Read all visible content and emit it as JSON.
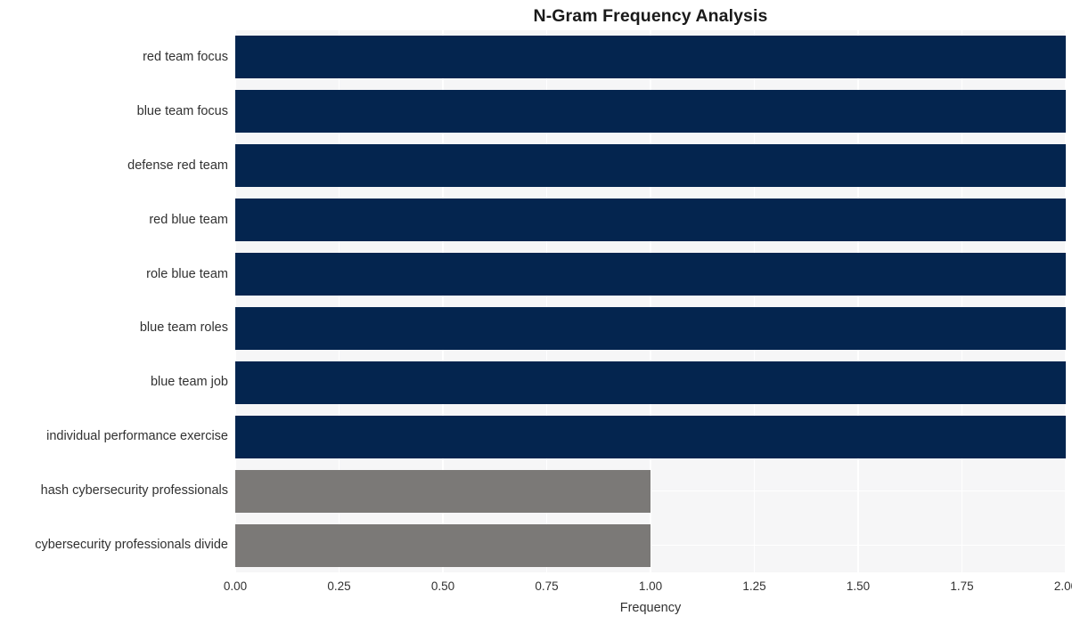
{
  "chart_data": {
    "type": "bar",
    "orientation": "horizontal",
    "title": "N-Gram Frequency Analysis",
    "xlabel": "Frequency",
    "ylabel": "",
    "xlim": [
      0,
      2
    ],
    "ylim": null,
    "grid": true,
    "legend": null,
    "xticks": [
      "0.00",
      "0.25",
      "0.50",
      "0.75",
      "1.00",
      "1.25",
      "1.50",
      "1.75",
      "2.00"
    ],
    "xtick_values": [
      0,
      0.25,
      0.5,
      0.75,
      1.0,
      1.25,
      1.5,
      1.75,
      2.0
    ],
    "categories": [
      "red team focus",
      "blue team focus",
      "defense red team",
      "red blue team",
      "role blue team",
      "blue team roles",
      "blue team job",
      "individual performance exercise",
      "hash cybersecurity professionals",
      "cybersecurity professionals divide"
    ],
    "values": [
      2,
      2,
      2,
      2,
      2,
      2,
      2,
      2,
      1,
      1
    ],
    "bar_colors": [
      "#04254f",
      "#04254f",
      "#04254f",
      "#04254f",
      "#04254f",
      "#04254f",
      "#04254f",
      "#04254f",
      "#7b7977",
      "#7b7977"
    ]
  },
  "style": {
    "plot_background": "#f6f6f7",
    "figure_background": "#ffffff",
    "grid_color": "#ffffff",
    "text_color": "#313131",
    "title_color": "#1a1a1a",
    "accent_primary": "#04254f",
    "accent_secondary": "#7b7977"
  }
}
